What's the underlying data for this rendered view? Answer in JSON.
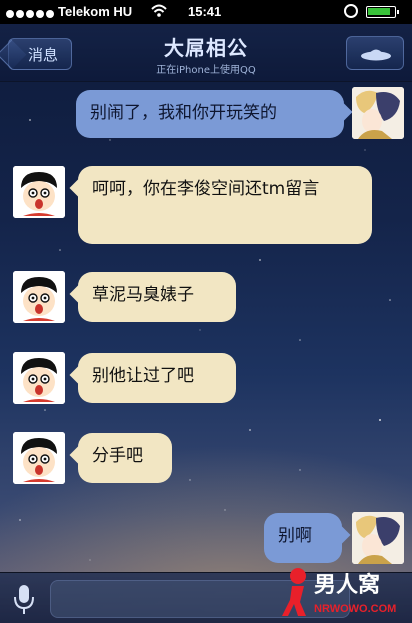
{
  "status_bar": {
    "carrier": "Telekom HU",
    "time": "15:41"
  },
  "nav": {
    "back_label": "消息",
    "title": "大屌相公",
    "subtitle": "正在iPhone上使用QQ"
  },
  "messages": [
    {
      "side": "right",
      "text": "别闹了，我和你开玩笑的"
    },
    {
      "side": "left",
      "text": "呵呵，你在李俊空间还tm留言"
    },
    {
      "side": "left",
      "text": "草泥马臭婊子"
    },
    {
      "side": "left",
      "text": "别他让过了吧"
    },
    {
      "side": "left",
      "text": "分手吧"
    },
    {
      "side": "right",
      "text": "别啊"
    }
  ],
  "watermark": {
    "brand": "男人窝",
    "url": "NRWOWO.COM"
  },
  "colors": {
    "left_bubble": "#f2e6c3",
    "right_bubble": "#7b9ad6",
    "nav_bg": "#142246",
    "battery": "#39c23a",
    "watermark_red": "#e8202a"
  }
}
